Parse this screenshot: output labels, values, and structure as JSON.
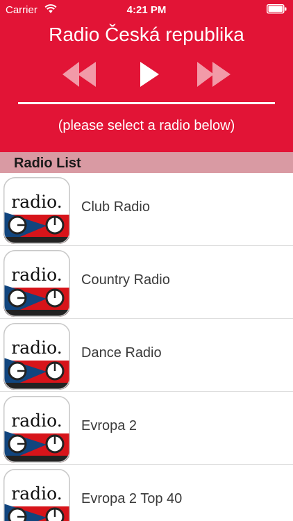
{
  "status_bar": {
    "carrier": "Carrier",
    "time": "4:21 PM"
  },
  "header": {
    "title": "Radio Česká republika",
    "hint": "(please select a radio below)",
    "controls": [
      "rewind-icon",
      "play-icon",
      "fast-forward-icon"
    ]
  },
  "section": {
    "title": "Radio List"
  },
  "radios": [
    {
      "label": "Club Radio",
      "logo_text": "radio."
    },
    {
      "label": "Country Radio",
      "logo_text": "radio."
    },
    {
      "label": "Dance Radio",
      "logo_text": "radio."
    },
    {
      "label": "Evropa 2",
      "logo_text": "radio."
    },
    {
      "label": "Evropa 2 Top 40",
      "logo_text": "radio."
    }
  ],
  "colors": {
    "header_bg": "#e21436",
    "section_bg": "#d99aa3",
    "flag_red": "#d7141a",
    "flag_blue": "#11457e",
    "control_dim": "#f29aa8"
  }
}
